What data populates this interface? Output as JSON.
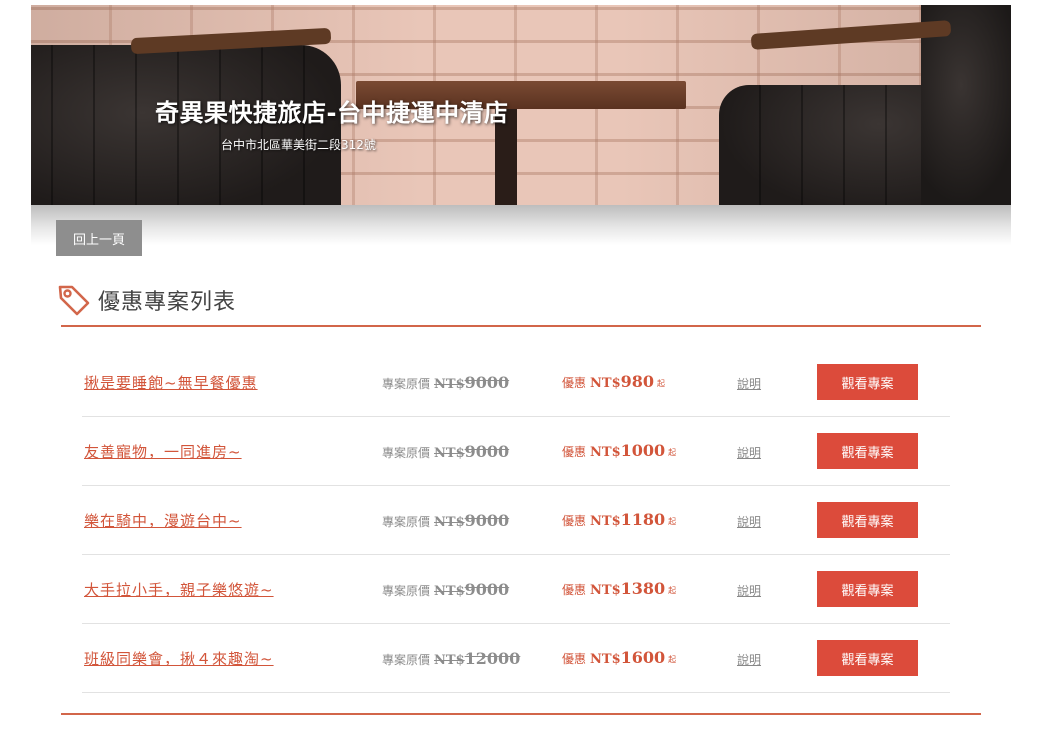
{
  "banner": {
    "hotel_name": "奇異果快捷旅店-台中捷運中清店",
    "address": "台中市北區華美街二段312號"
  },
  "nav": {
    "back_label": "回上一頁"
  },
  "section": {
    "title": "優惠專案列表",
    "icon": "price-tag-icon",
    "accent_color": "#d2664a"
  },
  "labels": {
    "original_price_label": "專案原價",
    "promo_price_label": "優惠",
    "currency": "NT$",
    "from_suffix": "起",
    "explain_label": "說明",
    "view_button_label": "觀看專案"
  },
  "colors": {
    "button_red": "#dc4b3b",
    "link_red": "#d2553a",
    "back_button_gray": "#8e8e8e"
  },
  "plans": [
    {
      "name": "揪是要睡飽~無早餐優惠",
      "original_price": "9000",
      "promo_price": "980"
    },
    {
      "name": "友善寵物，一同進房~",
      "original_price": "9000",
      "promo_price": "1000"
    },
    {
      "name": "樂在騎中，漫遊台中~",
      "original_price": "9000",
      "promo_price": "1180"
    },
    {
      "name": "大手拉小手，親子樂悠遊~",
      "original_price": "9000",
      "promo_price": "1380"
    },
    {
      "name": "班級同樂會，揪４來趣淘~",
      "original_price": "12000",
      "promo_price": "1600"
    }
  ]
}
